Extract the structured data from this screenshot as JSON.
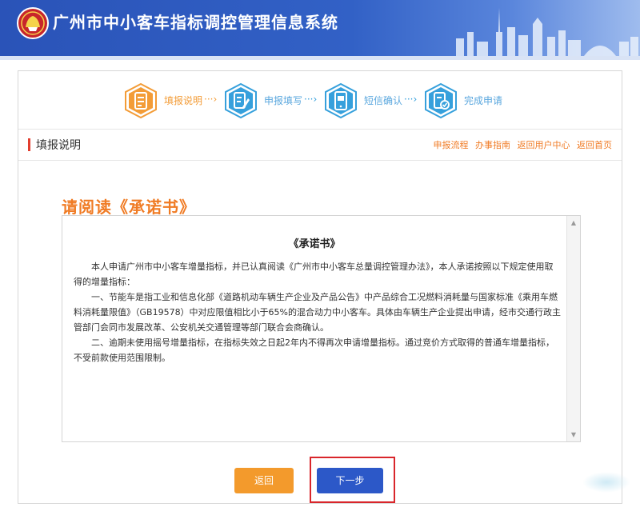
{
  "header": {
    "title": "广州市中小客车指标调控管理信息系统"
  },
  "steps": [
    {
      "label": "填报说明",
      "arrow": "···›",
      "state": "done",
      "icon": "document-icon"
    },
    {
      "label": "申报填写",
      "arrow": "···›",
      "state": "todo",
      "icon": "edit-form-icon"
    },
    {
      "label": "短信确认",
      "arrow": "···›",
      "state": "todo",
      "icon": "phone-message-icon"
    },
    {
      "label": "完成申请",
      "arrow": "",
      "state": "todo",
      "icon": "approved-document-icon"
    }
  ],
  "section": {
    "title": "填报说明",
    "links": [
      "申报流程",
      "办事指南",
      "返回用户中心",
      "返回首页"
    ]
  },
  "heading": "请阅读《承诺书》",
  "document": {
    "title": "《承诺书》",
    "paragraphs": [
      "本人申请广州市中小客车增量指标，并已认真阅读《广州市中小客车总量调控管理办法》，本人承诺按照以下规定使用取得的增量指标：",
      "一、节能车是指工业和信息化部《道路机动车辆生产企业及产品公告》中产品综合工况燃料消耗量与国家标准《乘用车燃料消耗量限值》（GB19578）中对应限值相比小于65%的混合动力中小客车。具体由车辆生产企业提出申请，经市交通行政主管部门会同市发展改革、公安机关交通管理等部门联合会商确认。",
      "二、逾期未使用摇号增量指标，在指标失效之日起2年内不得再次申请增量指标。通过竞价方式取得的普通车增量指标，不受前款使用范围限制。"
    ]
  },
  "buttons": {
    "back": "返回",
    "next": "下一步"
  },
  "colors": {
    "header_blue": "#2a53b8",
    "accent_orange": "#f07b24",
    "step_done": "#f39c37",
    "step_todo": "#36a0dc",
    "next_button": "#2c58c8",
    "highlight_red": "#d9262b"
  }
}
